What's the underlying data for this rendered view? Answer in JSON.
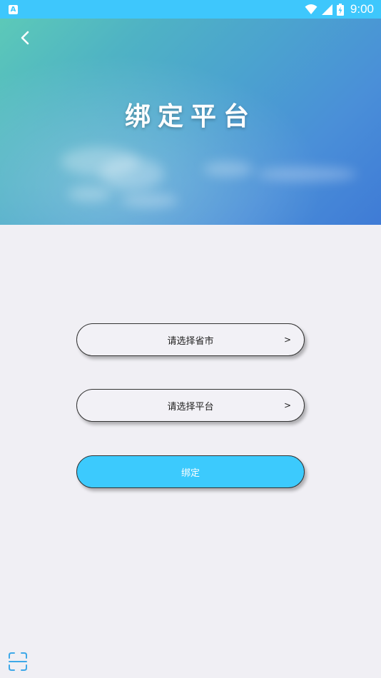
{
  "status_bar": {
    "notification": "A",
    "time": "9:00",
    "icons": [
      "wifi-icon",
      "signal-icon",
      "battery-icon"
    ]
  },
  "header": {
    "back_icon": "chevron-left-icon",
    "title": "绑定平台"
  },
  "form": {
    "province_select": {
      "label": "请选择省市",
      "arrow": ">"
    },
    "platform_select": {
      "label": "请选择平台",
      "arrow": ">"
    },
    "bind_button": {
      "label": "绑定"
    }
  },
  "footer": {
    "scan_icon": "scan-icon"
  },
  "colors": {
    "status_bar": "#3ec7fc",
    "page_background": "#f0eff4",
    "bind_button": "#3ccafd",
    "scan_icon": "#3ea8e8"
  }
}
